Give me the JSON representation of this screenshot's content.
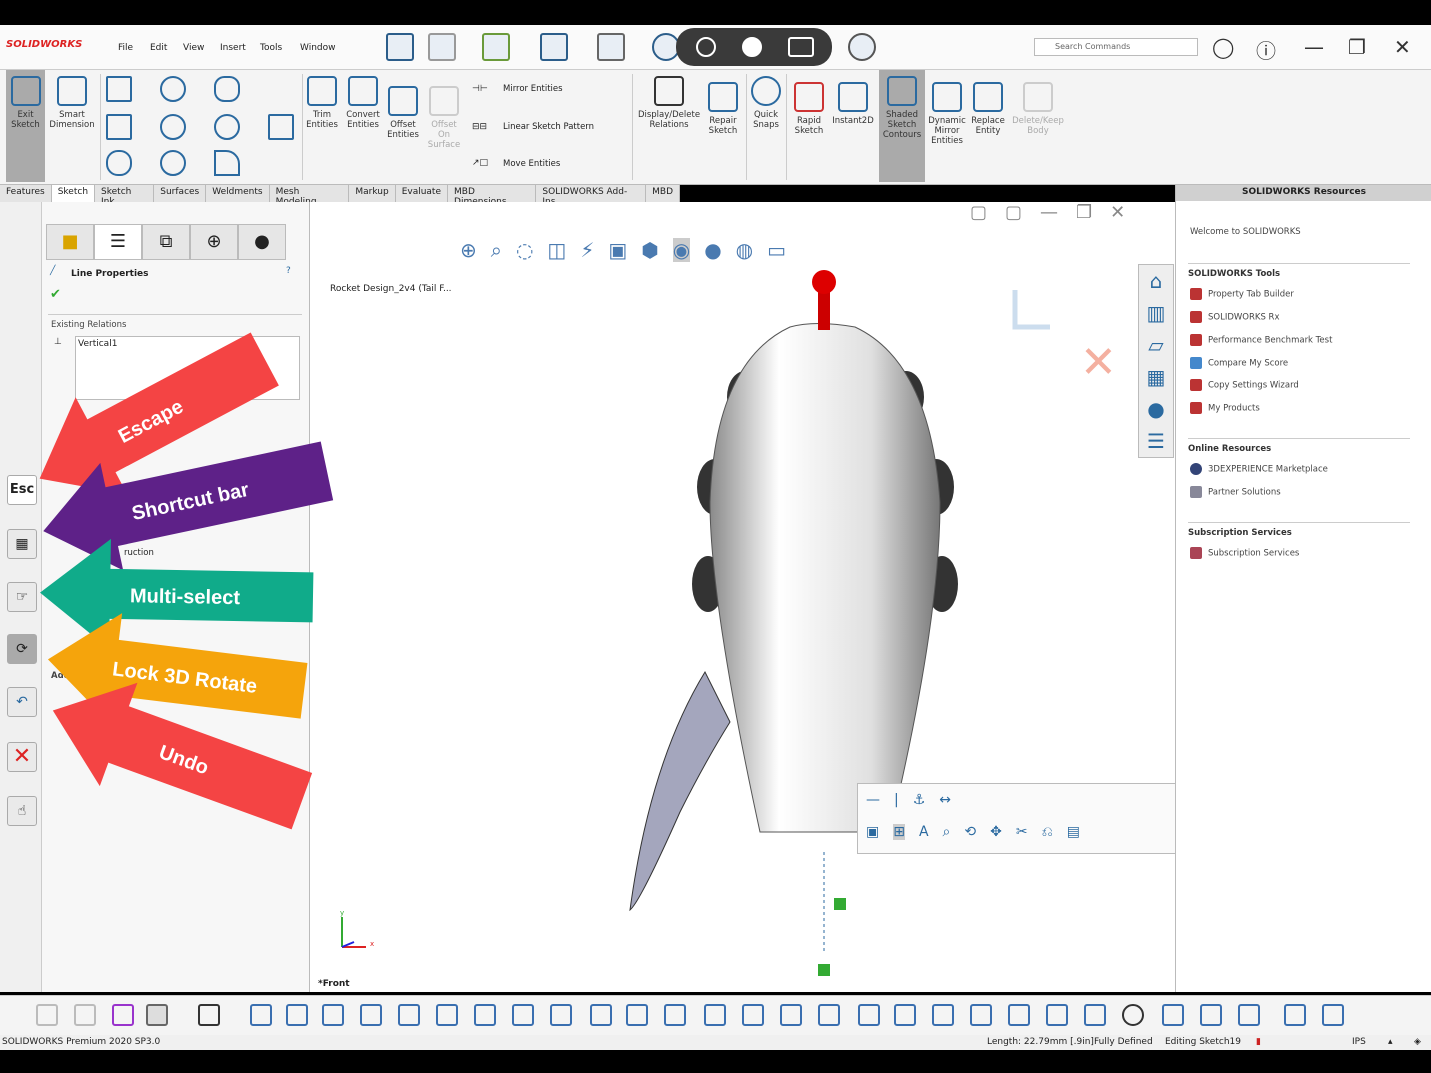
{
  "app": {
    "logo": "SOLIDWORKS",
    "menu": [
      "File",
      "Edit",
      "View",
      "Insert",
      "Tools",
      "Window"
    ],
    "search_placeholder": "Search Commands"
  },
  "ribbon": {
    "exit_sketch": "Exit Sketch",
    "smart_dimension": "Smart Dimension",
    "trim": "Trim Entities",
    "convert": "Convert Entities",
    "offset": "Offset Entities",
    "offset_surface": "Offset On Surface",
    "mirror": "Mirror Entities",
    "linear_pattern": "Linear Sketch Pattern",
    "move": "Move Entities",
    "display_relations": "Display/Delete Relations",
    "repair": "Repair Sketch",
    "quick_snaps": "Quick Snaps",
    "rapid": "Rapid Sketch",
    "instant2d": "Instant2D",
    "shaded": "Shaded Sketch Contours",
    "dynamic_mirror": "Dynamic Mirror Entities",
    "replace": "Replace Entity",
    "delete_keep": "Delete/Keep Body"
  },
  "tabs": [
    "Features",
    "Sketch",
    "Sketch Ink",
    "Surfaces",
    "Weldments",
    "Mesh Modeling",
    "Markup",
    "Evaluate",
    "MBD Dimensions",
    "SOLIDWORKS Add-Ins",
    "MBD"
  ],
  "active_tab": "Sketch",
  "property_manager": {
    "title": "Line Properties",
    "existing_relations": "Existing Relations",
    "relations": [
      "Vertical1"
    ],
    "partial_construction": "ruction",
    "add_partial": "Add"
  },
  "shortcut_strip": {
    "esc": "Esc"
  },
  "annotations": [
    {
      "label": "Escape",
      "color": "#f44444"
    },
    {
      "label": "Shortcut bar",
      "color": "#5e2188"
    },
    {
      "label": "Multi-select",
      "color": "#10ab8a"
    },
    {
      "label": "Lock 3D Rotate",
      "color": "#f5a40c"
    },
    {
      "label": "Undo",
      "color": "#f44444"
    }
  ],
  "viewport": {
    "tree_item": "Rocket Design_2v4  (Tail F...",
    "view_label": "*Front",
    "axis_x": "x",
    "axis_y": "y"
  },
  "resources": {
    "title": "SOLIDWORKS Resources",
    "welcome": "Welcome to SOLIDWORKS",
    "sections": [
      {
        "title": "SOLIDWORKS Tools",
        "items": [
          "Property Tab Builder",
          "SOLIDWORKS Rx",
          "Performance Benchmark Test",
          "Compare My Score",
          "Copy Settings Wizard",
          "My Products"
        ]
      },
      {
        "title": "Online Resources",
        "items": [
          "3DEXPERIENCE Marketplace",
          "Partner Solutions"
        ]
      },
      {
        "title": "Subscription Services",
        "items": [
          "Subscription Services"
        ]
      }
    ]
  },
  "status": {
    "product": "SOLIDWORKS Premium 2020 SP3.0",
    "length": "Length: 22.79mm [.9in]",
    "defined": "Fully Defined",
    "editing": "Editing Sketch19",
    "units": "IPS"
  }
}
